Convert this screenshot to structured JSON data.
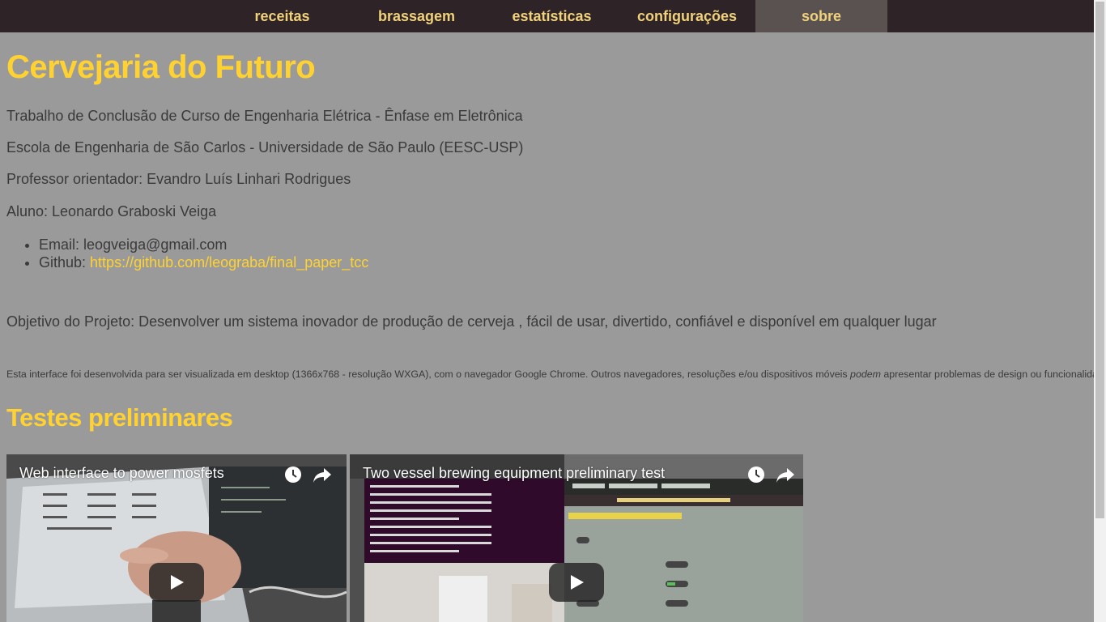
{
  "nav": {
    "items": [
      {
        "label": "receitas"
      },
      {
        "label": "brassagem"
      },
      {
        "label": "estatísticas"
      },
      {
        "label": "configurações"
      },
      {
        "label": "sobre",
        "active": true
      }
    ]
  },
  "page": {
    "title": "Cervejaria do Futuro",
    "course": "Trabalho de Conclusão de Curso de Engenharia Elétrica - Ênfase em Eletrônica",
    "school": "Escola de Engenharia de São Carlos - Universidade de São Paulo (EESC-USP)",
    "advisor": "Professor orientador: Evandro Luís Linhari Rodrigues",
    "student": "Aluno: Leonardo Graboski Veiga",
    "contacts": {
      "email_prefix": "Email: ",
      "email": "leogveiga@gmail.com",
      "github_prefix": "Github: ",
      "github_url": "https://github.com/leograba/final_paper_tcc"
    },
    "objective": "Objetivo do Projeto: Desenvolver um sistema inovador de produção de cerveja , fácil de usar, divertido, confiável e disponível em qualquer lugar",
    "note_before": "Esta interface foi desenvolvida para ser visualizada em desktop (1366x768 - resolução WXGA), com o navegador Google Chrome. Outros navegadores, resoluções e/ou dispositivos móveis ",
    "note_em": "podem",
    "note_after": " apresentar problemas de design ou funcionalidade",
    "section_title": "Testes preliminares"
  },
  "videos": [
    {
      "title": "Web interface to power mosfets"
    },
    {
      "title": "Two vessel brewing equipment preliminary test"
    }
  ],
  "colors": {
    "accent": "#ffd231",
    "nav_bg": "#2e2326",
    "nav_text": "#f0d27c",
    "nav_active_bg": "#5a5250",
    "page_bg": "#9a9a9a"
  },
  "icons": [
    "clock-icon",
    "share-icon",
    "play-icon"
  ]
}
